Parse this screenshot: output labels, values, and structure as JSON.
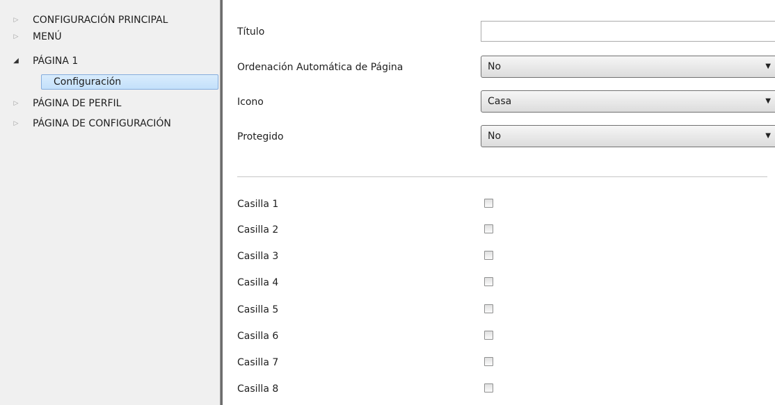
{
  "sidebar": {
    "items": [
      {
        "label": "CONFIGURACIÓN PRINCIPAL",
        "expander": "collapsed-arrow-icon"
      },
      {
        "label": "MENÚ",
        "expander": "collapsed-arrow-icon"
      },
      {
        "label": "PÁGINA 1",
        "expander": "expanded-arrow-icon"
      },
      {
        "label": "Configuración",
        "selected": true
      },
      {
        "label": "PÁGINA DE PERFIL",
        "expander": "collapsed-arrow-icon"
      },
      {
        "label": "PÁGINA DE CONFIGURACIÓN",
        "expander": "collapsed-arrow-icon"
      }
    ]
  },
  "form": {
    "title_label": "Título",
    "title_value": "",
    "auto_order_label": "Ordenación Automática de Página",
    "auto_order_value": "No",
    "icon_label": "Icono",
    "icon_value": "Casa",
    "protected_label": "Protegido",
    "protected_value": "No"
  },
  "checkboxes": [
    {
      "label": "Casilla 1",
      "checked": false
    },
    {
      "label": "Casilla 2",
      "checked": false
    },
    {
      "label": "Casilla 3",
      "checked": false
    },
    {
      "label": "Casilla 4",
      "checked": false
    },
    {
      "label": "Casilla 5",
      "checked": false
    },
    {
      "label": "Casilla 6",
      "checked": false
    },
    {
      "label": "Casilla 7",
      "checked": false
    },
    {
      "label": "Casilla 8",
      "checked": false
    }
  ],
  "colors": {
    "selection_bg": "#c3e0fb",
    "selection_border": "#84acdd",
    "sidebar_bg": "#f0f0f0",
    "splitter": "#6d6d6d"
  }
}
